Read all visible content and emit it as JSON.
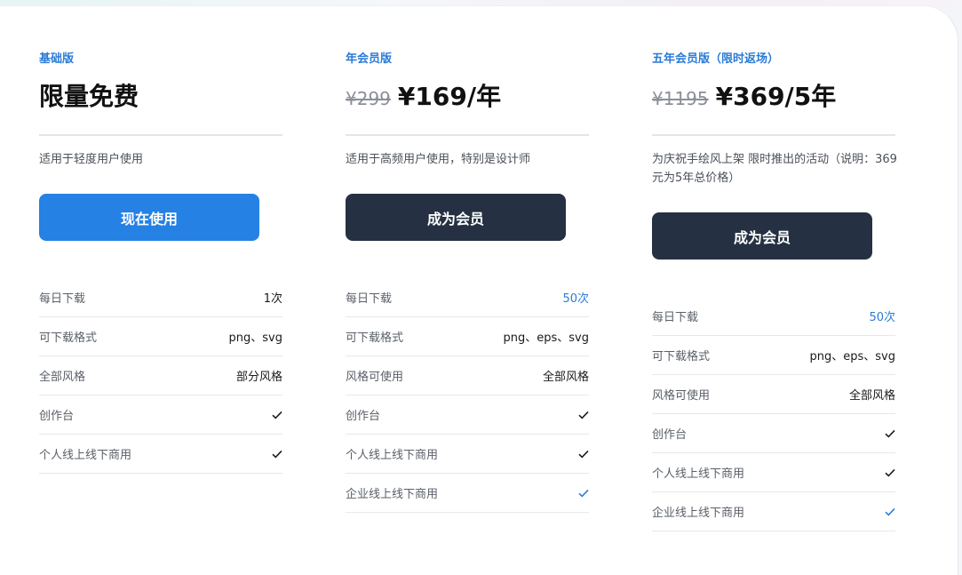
{
  "plans": [
    {
      "tier": "基础版",
      "old_price": "",
      "price": "限量免费",
      "description": "适用于轻度用户使用",
      "button_label": "现在使用",
      "features": [
        {
          "label": "每日下载",
          "value": "1次"
        },
        {
          "label": "可下载格式",
          "value": "png、svg"
        },
        {
          "label": "全部风格",
          "value": "部分风格"
        },
        {
          "label": "创作台",
          "value": "check"
        },
        {
          "label": "个人线上线下商用",
          "value": "check"
        }
      ]
    },
    {
      "tier": "年会员版",
      "old_price": "¥299",
      "price": "¥169/年",
      "description": "适用于高频用户使用，特别是设计师",
      "button_label": "成为会员",
      "features": [
        {
          "label": "每日下载",
          "value": "50次"
        },
        {
          "label": "可下载格式",
          "value": "png、eps、svg"
        },
        {
          "label": "风格可使用",
          "value": "全部风格"
        },
        {
          "label": "创作台",
          "value": "check"
        },
        {
          "label": "个人线上线下商用",
          "value": "check"
        },
        {
          "label": "企业线上线下商用",
          "value": "check"
        }
      ]
    },
    {
      "tier": "五年会员版（限时返场）",
      "old_price": "¥1195",
      "price": "¥369/5年",
      "description": "为庆祝手绘风上架 限时推出的活动（说明：369元为5年总价格）",
      "button_label": "成为会员",
      "features": [
        {
          "label": "每日下载",
          "value": "50次"
        },
        {
          "label": "可下载格式",
          "value": "png、eps、svg"
        },
        {
          "label": "风格可使用",
          "value": "全部风格"
        },
        {
          "label": "创作台",
          "value": "check"
        },
        {
          "label": "个人线上线下商用",
          "value": "check"
        },
        {
          "label": "企业线上线下商用",
          "value": "check"
        }
      ]
    }
  ],
  "colors": {
    "accent_blue": "#2581e3",
    "dark_button": "#253142",
    "tier_label": "#2b7bd6",
    "check_dark": "#1a1a1a",
    "check_blue": "#2b7bd6"
  }
}
